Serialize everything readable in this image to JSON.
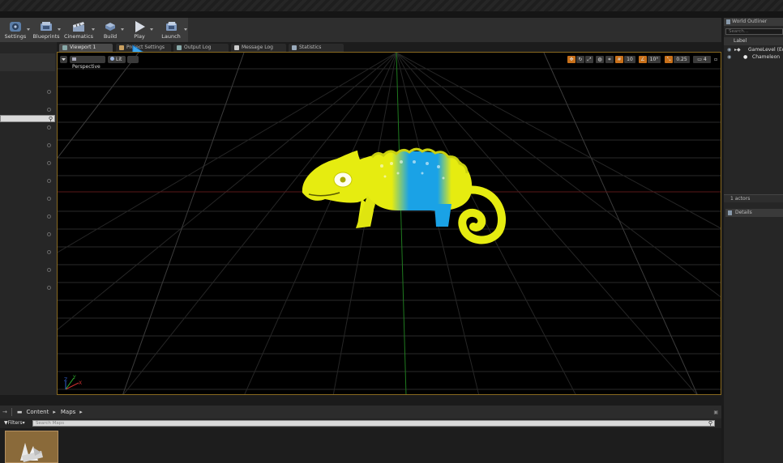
{
  "toolbar": {
    "buttons": [
      {
        "label": "Settings",
        "icon": "settings-gear-icon"
      },
      {
        "label": "Blueprints",
        "icon": "blueprints-icon"
      },
      {
        "label": "Cinematics",
        "icon": "cinematics-clapper-icon"
      },
      {
        "label": "Build",
        "icon": "build-icon"
      },
      {
        "label": "Play",
        "icon": "play-icon"
      },
      {
        "label": "Launch",
        "icon": "launch-icon"
      }
    ]
  },
  "tabs": [
    {
      "label": "Viewport 1",
      "active": true
    },
    {
      "label": "Project Settings",
      "active": false
    },
    {
      "label": "Output Log",
      "active": false
    },
    {
      "label": "Message Log",
      "active": false
    },
    {
      "label": "Statistics",
      "active": false
    }
  ],
  "viewport": {
    "perspective_label": "Perspective",
    "lit_label": "Lit",
    "grid_snap": "10",
    "rotation_snap": "10°",
    "scale_snap": "0.25",
    "camera_speed": "4",
    "axis_y": "Y",
    "axis_x": "X",
    "axis_z": "Z"
  },
  "outliner": {
    "title": "World Outliner",
    "search_placeholder": "Search...",
    "column_label": "Label",
    "rows": [
      "GameLevel (Editor)",
      "Chameleon"
    ],
    "actor_count": "1 actors"
  },
  "details": {
    "title": "Details"
  },
  "content_browser": {
    "path_content": "Content",
    "path_maps": "Maps",
    "filters_label": "Filters",
    "search_placeholder": "Search Maps"
  },
  "colors": {
    "accent_orange": "#c8701a",
    "highlight_arrow": "#3aa6f0",
    "chameleon_yellow": "#e6ec10",
    "chameleon_blue": "#1aa2e6"
  }
}
